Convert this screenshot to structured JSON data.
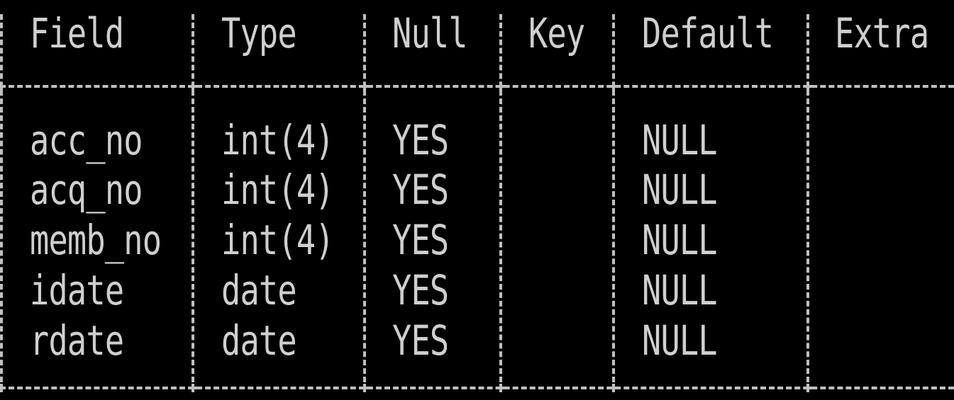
{
  "table": {
    "columns": [
      "Field",
      "Type",
      "Null",
      "Key",
      "Default",
      "Extra"
    ],
    "rows": [
      [
        "acc_no",
        "int(4)",
        "YES",
        "",
        "NULL",
        ""
      ],
      [
        "acq_no",
        "int(4)",
        "YES",
        "",
        "NULL",
        ""
      ],
      [
        "memb_no",
        "int(4)",
        "YES",
        "",
        "NULL",
        ""
      ],
      [
        "idate",
        "date",
        "YES",
        "",
        "NULL",
        ""
      ],
      [
        "rdate",
        "date",
        "YES",
        "",
        "NULL",
        ""
      ]
    ]
  },
  "colors": {
    "background": "#000000",
    "text": "#cfcfcf",
    "border": "#c0c0c0"
  }
}
